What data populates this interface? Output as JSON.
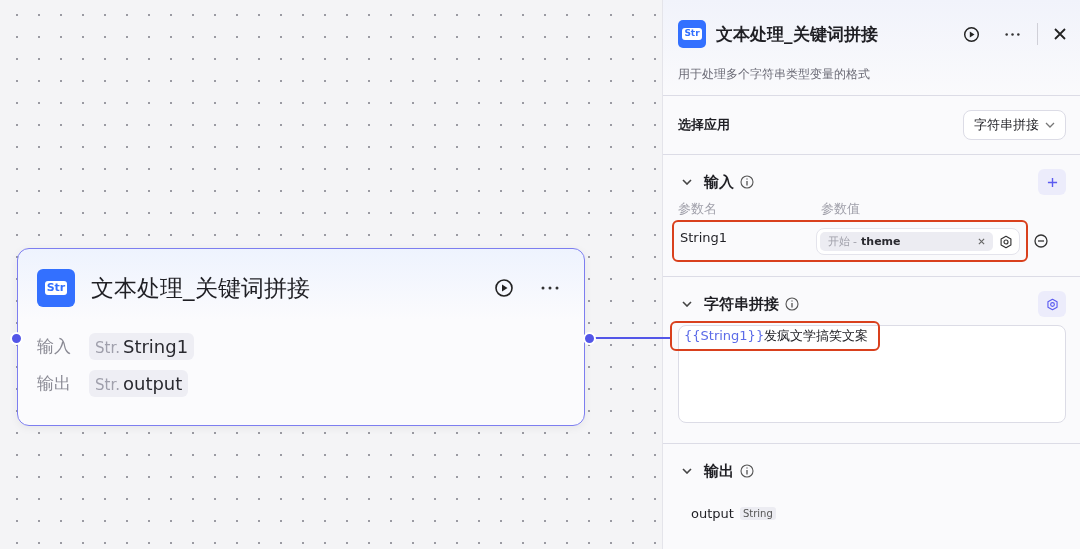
{
  "node": {
    "icon_text": "Str",
    "title": "文本处理_关键词拼接",
    "inputs_label": "输入",
    "input": {
      "type_tag": "Str.",
      "name": "String1"
    },
    "outputs_label": "输出",
    "output": {
      "type_tag": "Str.",
      "name": "output"
    }
  },
  "panel": {
    "icon_text": "Str",
    "title": "文本处理_关键词拼接",
    "description": "用于处理多个字符串类型变量的格式",
    "app_select": {
      "label": "选择应用",
      "value": "字符串拼接"
    },
    "input_section": {
      "title": "输入",
      "expanded": true,
      "columns": [
        "参数名",
        "参数值"
      ],
      "params": [
        {
          "name": "String1",
          "source": "开始 -",
          "variable": "theme",
          "highlighted": true
        }
      ]
    },
    "concat_section": {
      "title": "字符串拼接",
      "expanded": true,
      "template": {
        "variable": "{{String1}}",
        "text": "发疯文学搞笑文案",
        "highlighted": true
      }
    },
    "output_section": {
      "title": "输出",
      "expanded": true,
      "outputs": [
        {
          "name": "output",
          "type": "String"
        }
      ]
    }
  }
}
